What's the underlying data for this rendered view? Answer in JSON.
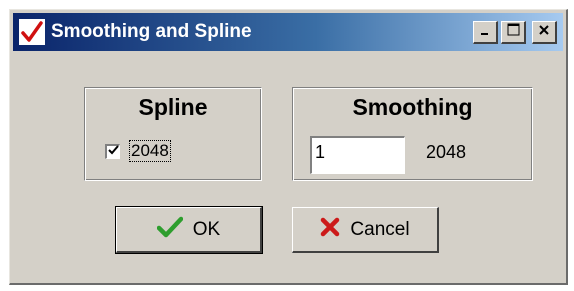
{
  "window": {
    "title": "Smoothing and Spline",
    "app_icon": "red-check-icon",
    "title_buttons": [
      "minimize-icon",
      "maximize-icon",
      "close-icon"
    ]
  },
  "spline": {
    "group_title": "Spline",
    "checkbox_checked": true,
    "checkbox_label": "2048"
  },
  "smoothing": {
    "group_title": "Smoothing",
    "input_value": "1",
    "value_label": "2048"
  },
  "buttons": {
    "ok_label": "OK",
    "ok_icon": "green-check-icon",
    "cancel_label": "Cancel",
    "cancel_icon": "red-x-icon"
  },
  "colors": {
    "title_gradient_start": "#0a246a",
    "title_gradient_end": "#a6caf0",
    "face": "#d4d0c8",
    "ok_check": "#2e9e2e",
    "cancel_x": "#cc1a1a"
  }
}
